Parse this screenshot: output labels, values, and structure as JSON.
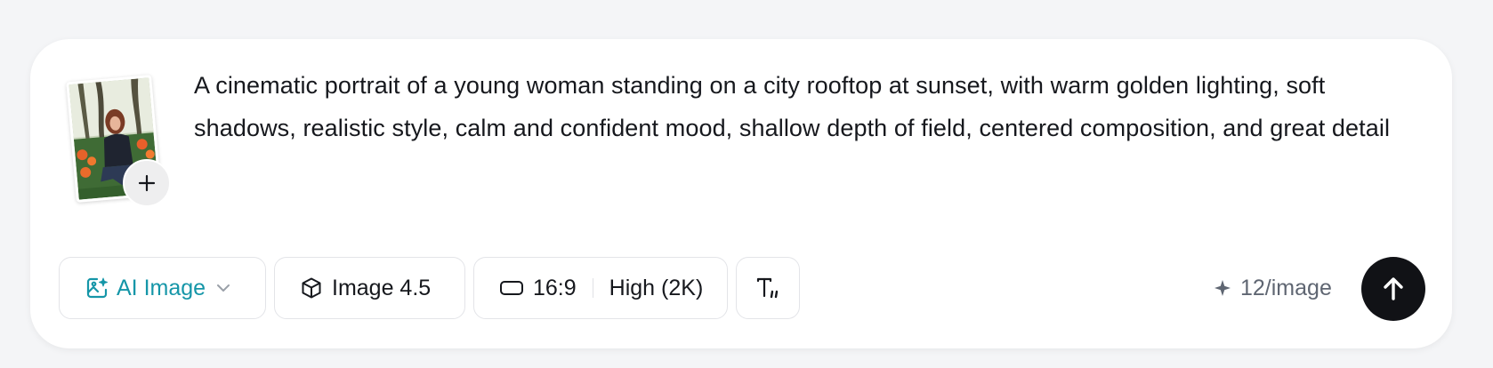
{
  "prompt": {
    "text": "A cinematic portrait of a young woman standing on a city rooftop at sunset, with warm golden lighting, soft shadows, realistic style, calm and confident mood, shallow depth of field, centered composition, and great detail"
  },
  "reference_image": {
    "icon": "plus-icon"
  },
  "toolbar": {
    "model_type": {
      "label": "AI Image",
      "icon": "ai-image-icon",
      "accent": "#1596a8"
    },
    "model": {
      "label": "Image 4.5",
      "icon": "cube-icon"
    },
    "ratio": {
      "label": "16:9",
      "icon": "aspect-ratio-icon"
    },
    "quality": {
      "label": "High (2K)"
    },
    "text_style": {
      "icon": "text-quote-icon"
    }
  },
  "cost": {
    "label": "12/image",
    "icon": "sparkle-icon"
  },
  "send": {
    "icon": "arrow-up-icon",
    "color": "#111216"
  }
}
